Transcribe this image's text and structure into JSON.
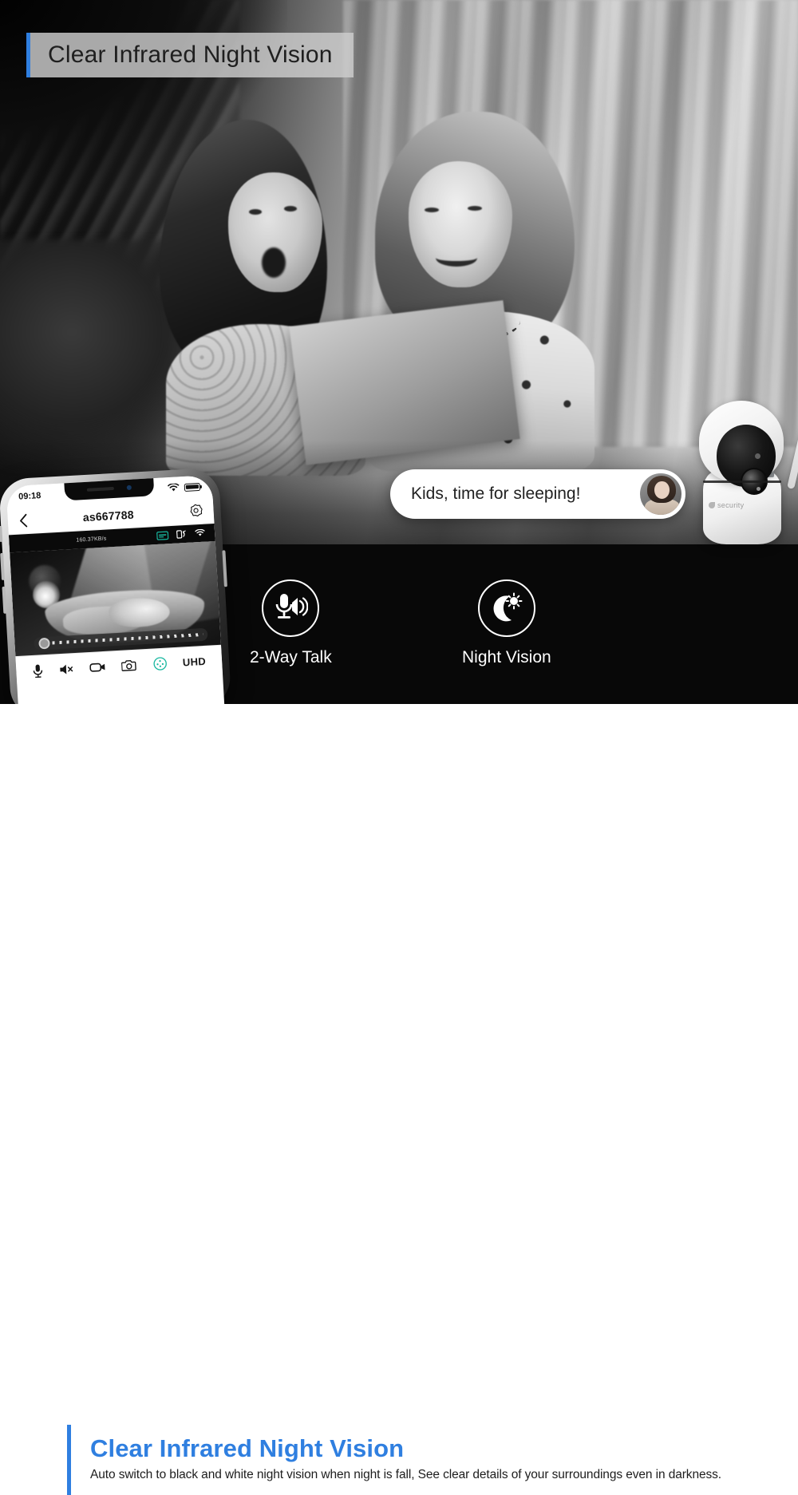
{
  "hero": {
    "top_banner": {
      "title": "Clear Infrared Night Vision"
    },
    "scene_alt": "Two young girls in pajamas smiling at each other while looking at a book in bed under a canopy, shown in black-and-white infrared night vision",
    "speech_bubble": {
      "message": "Kids, time for sleeping!",
      "avatar_icon": "woman-avatar-photo"
    },
    "features": [
      {
        "label": "2-Way Talk",
        "icon": "mic-speaker-icon"
      },
      {
        "label": "Night Vision",
        "icon": "moon-sun-icon"
      }
    ],
    "camera_device": {
      "brand": "security",
      "brand_mark_icon": "shield-logo-icon",
      "antenna_icon": "antenna-icon",
      "lens_icon": "camera-lens-icon"
    }
  },
  "phone": {
    "status_bar": {
      "time": "09:18",
      "wifi_icon": "wifi-icon",
      "battery_icon": "battery-full-icon"
    },
    "nav_bar": {
      "back_icon": "chevron-left-icon",
      "title": "as667788",
      "settings_icon": "gear-icon"
    },
    "stats_bar": {
      "bitrate": "160.37KB/s",
      "sd_card_icon": "sd-card-icon",
      "rotate_icon": "screen-rotate-icon",
      "wifi_icon": "wifi-icon"
    },
    "video_alt": "Night vision view of a baby sleeping in a bassinet with a glowing nightlight",
    "seek_bar": {
      "handle_icon": "seek-handle-icon"
    },
    "controls": [
      {
        "name": "microphone",
        "icon": "microphone-icon",
        "label": ""
      },
      {
        "name": "speaker-mute",
        "icon": "speaker-mute-icon",
        "label": ""
      },
      {
        "name": "record",
        "icon": "video-record-icon",
        "label": ""
      },
      {
        "name": "snapshot",
        "icon": "camera-snapshot-icon",
        "label": ""
      },
      {
        "name": "ptz",
        "icon": "ptz-direction-icon",
        "label": ""
      },
      {
        "name": "quality",
        "icon": "",
        "label": "UHD"
      }
    ]
  },
  "caption": {
    "title": "Clear Infrared Night Vision",
    "subtitle": "Auto switch to black and white night vision when night is fall, See clear details of your surroundings even in darkness."
  },
  "colors": {
    "accent_blue": "#2f7fe0",
    "banner_bg": "#cdcdcd",
    "ptz_teal": "#18b8a0",
    "caption_text": "#1d1d1d"
  }
}
